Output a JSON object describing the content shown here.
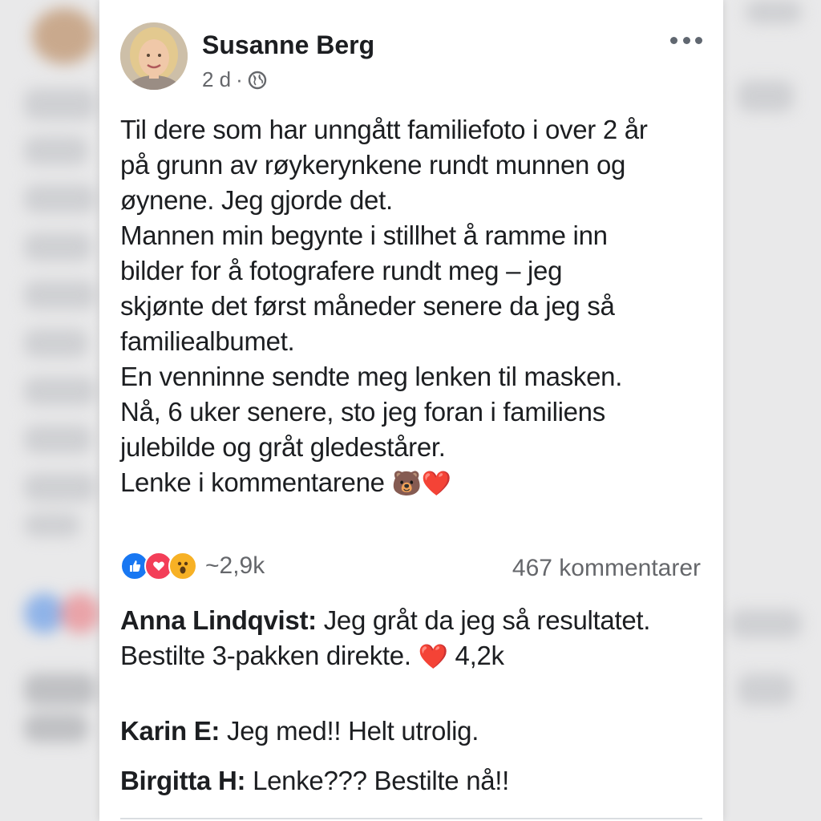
{
  "post": {
    "author": "Susanne Berg",
    "time": "2 d",
    "separator": "·",
    "privacy_icon": "globe-icon",
    "more_icon": "more-options-icon",
    "text_lines": [
      "Til dere som har unngått familiefoto i over 2 år",
      "på grunn av røykerynkene rundt munnen og",
      "øynene. Jeg gjorde det.",
      "Mannen min begynte i stillhet å ramme inn",
      "bilder for å fotografere rundt meg – jeg",
      "skjønte det først måneder senere da jeg så",
      "familiealbumet.",
      "En venninne sendte meg lenken til masken.",
      "Nå, 6 uker senere, sto jeg foran i familiens",
      "julebilde og gråt gledestårer."
    ],
    "last_line": "Lenke i kommentarene",
    "last_line_emoji": "🐻❤️"
  },
  "engagement": {
    "reaction_icons": [
      "like-icon",
      "love-icon",
      "wow-icon"
    ],
    "reaction_count": "~2,9k",
    "comment_count": "467 kommentarer"
  },
  "comments": [
    {
      "name": "Anna Lindqvist:",
      "text": " Jeg gråt da jeg så resultatet.",
      "text2": "Bestilte 3-pakken direkte. ",
      "emoji": "❤️",
      "likes": " 4,2k"
    },
    {
      "name": "Karin E:",
      "text": " Jeg med!! Helt utrolig."
    },
    {
      "name": "Birgitta H:",
      "text": " Lenke??? Bestilte nå!!"
    }
  ],
  "colors": {
    "like": "#1877f2",
    "love": "#f33e58",
    "wow": "#f7b125",
    "text": "#1c1e21",
    "muted": "#65676b"
  }
}
